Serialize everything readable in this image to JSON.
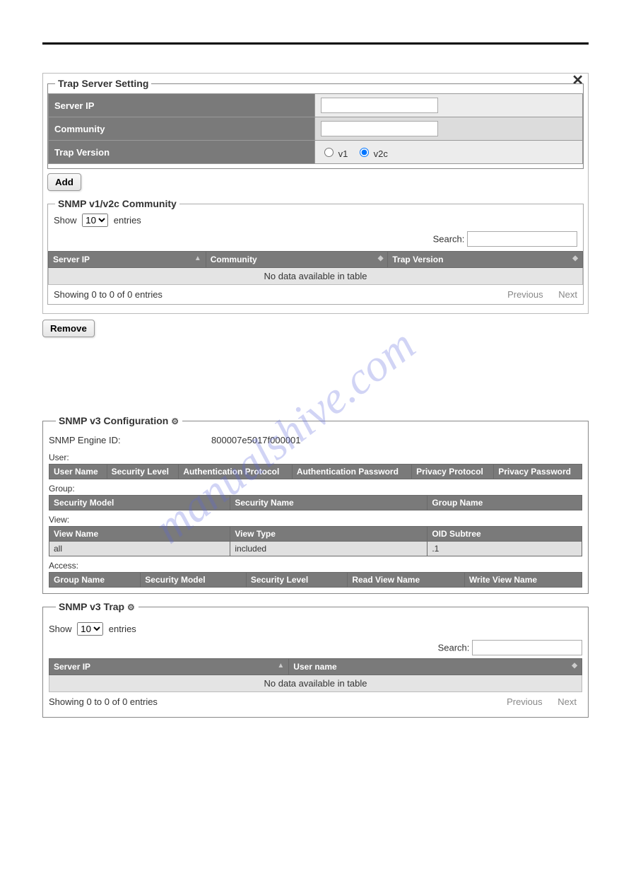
{
  "watermark": "manualshive.com",
  "trap_server": {
    "legend": "Trap Server Setting",
    "rows": {
      "server_ip": "Server IP",
      "community": "Community",
      "trap_version": "Trap Version",
      "v1_label": "v1",
      "v2c_label": "v2c"
    },
    "add_btn": "Add"
  },
  "community": {
    "legend": "SNMP v1/v2c Community",
    "show_label": "Show",
    "entries_label": "entries",
    "show_value": "10",
    "search_label": "Search:",
    "cols": {
      "server_ip": "Server IP",
      "community": "Community",
      "trap_version": "Trap Version"
    },
    "no_data": "No data available in table",
    "info": "Showing 0 to 0 of 0 entries",
    "previous": "Previous",
    "next": "Next"
  },
  "remove_btn": "Remove",
  "v3cfg": {
    "legend": "SNMP v3 Configuration",
    "engine_label": "SNMP Engine ID:",
    "engine_value": "800007e5017f000001",
    "sections": {
      "user": "User:",
      "group": "Group:",
      "view": "View:",
      "access": "Access:"
    },
    "user_cols": {
      "user_name": "User Name",
      "security_level": "Security Level",
      "auth_protocol": "Authentication Protocol",
      "auth_password": "Authentication Password",
      "priv_protocol": "Privacy Protocol",
      "priv_password": "Privacy Password"
    },
    "group_cols": {
      "security_model": "Security Model",
      "security_name": "Security Name",
      "group_name": "Group Name"
    },
    "view_cols": {
      "view_name": "View Name",
      "view_type": "View Type",
      "oid_subtree": "OID Subtree"
    },
    "view_row": {
      "name": "all",
      "type": "included",
      "oid": ".1"
    },
    "access_cols": {
      "group_name": "Group Name",
      "security_model": "Security Model",
      "security_level": "Security Level",
      "read_view": "Read View Name",
      "write_view": "Write View Name"
    }
  },
  "v3trap": {
    "legend": "SNMP v3 Trap",
    "show_label": "Show",
    "entries_label": "entries",
    "show_value": "10",
    "search_label": "Search:",
    "cols": {
      "server_ip": "Server IP",
      "user_name": "User name"
    },
    "no_data": "No data available in table",
    "info": "Showing 0 to 0 of 0 entries",
    "previous": "Previous",
    "next": "Next"
  }
}
